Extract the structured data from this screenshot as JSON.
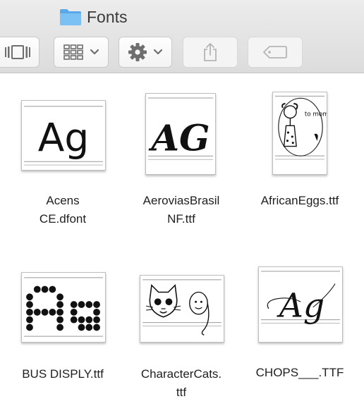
{
  "window": {
    "title": "Fonts"
  },
  "toolbar": {
    "buttons": [
      {
        "name": "cover-flow-view-button",
        "icon": "cover-flow-icon"
      },
      {
        "name": "arrange-button",
        "icon": "grid-icon"
      },
      {
        "name": "action-button",
        "icon": "gear-icon"
      },
      {
        "name": "share-button",
        "icon": "share-icon"
      },
      {
        "name": "tags-button",
        "icon": "tag-icon"
      }
    ]
  },
  "files": [
    {
      "name_line1": "Acens",
      "name_line2": "CE.dfont",
      "preview_text": "Ag"
    },
    {
      "name_line1": "AeroviasBrasil",
      "name_line2": "NF.ttf",
      "preview_text": "AG"
    },
    {
      "name_line1": "AfricanEggs.ttf",
      "name_line2": "",
      "preview_text": "to mom"
    },
    {
      "name_line1": "BUS DISPLY.ttf",
      "name_line2": "",
      "preview_text": "Ag"
    },
    {
      "name_line1": "CharacterCats.",
      "name_line2": "ttf",
      "preview_text": ""
    },
    {
      "name_line1": "CHOPS___.TTF",
      "name_line2": "",
      "preview_text": "Ag"
    }
  ],
  "colors": {
    "folder": "#6fb7ef",
    "toolbar_icon": "#6e6e6e",
    "toolbar_icon_disabled": "#b5b5b5"
  }
}
